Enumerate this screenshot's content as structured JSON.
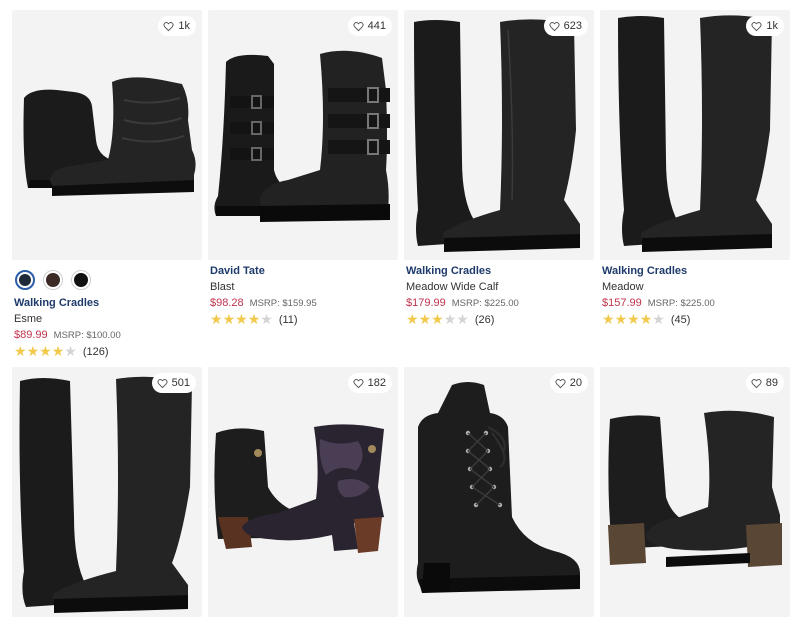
{
  "products": [
    {
      "brand": "Walking Cradles",
      "name": "Esme",
      "price": "$89.99",
      "msrp": "MSRP: $100.00",
      "rating": 4,
      "reviews": "(126)",
      "favorites": "1k",
      "swatches": [
        "#1e2a38",
        "#3b2a26",
        "#111111"
      ],
      "shoe_type": "ankle-bootie"
    },
    {
      "brand": "David Tate",
      "name": "Blast",
      "price": "$98.28",
      "msrp": "MSRP: $159.95",
      "rating": 4,
      "reviews": "(11)",
      "favorites": "441",
      "shoe_type": "buckle-moto-boot"
    },
    {
      "brand": "Walking Cradles",
      "name": "Meadow Wide Calf",
      "price": "$179.99",
      "msrp": "MSRP: $225.00",
      "rating": 3,
      "reviews": "(26)",
      "favorites": "623",
      "shoe_type": "tall-riding-boot"
    },
    {
      "brand": "Walking Cradles",
      "name": "Meadow",
      "price": "$157.99",
      "msrp": "MSRP: $225.00",
      "rating": 4,
      "reviews": "(45)",
      "favorites": "1k",
      "shoe_type": "tall-riding-boot"
    },
    {
      "favorites": "501",
      "shoe_type": "tall-riding-boot"
    },
    {
      "favorites": "182",
      "shoe_type": "floral-heeled-bootie"
    },
    {
      "favorites": "20",
      "shoe_type": "lace-up-combat-boot"
    },
    {
      "favorites": "89",
      "shoe_type": "block-heel-ankle-boot"
    }
  ],
  "icons": {
    "favorite": "heart-outline-icon",
    "rating": "star-icon"
  },
  "colors": {
    "brand": "#1d3a6b",
    "price": "#c0334d",
    "star": "#f2c94c",
    "star_empty": "#d4d4d4"
  }
}
